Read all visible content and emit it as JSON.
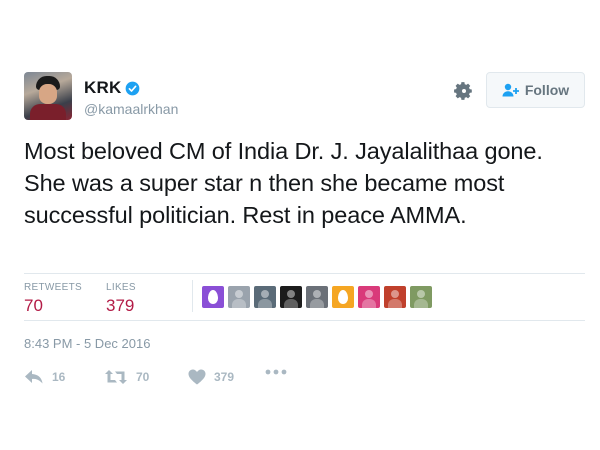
{
  "user": {
    "name": "KRK",
    "handle": "@kamaalrkhan",
    "verified": true
  },
  "follow_button": {
    "label": "Follow"
  },
  "tweet": {
    "text": "Most beloved CM of India Dr. J. Jayalalithaa gone. She was a super star n then she became most successful politician. Rest in peace AMMA.",
    "timestamp": "8:43 PM - 5 Dec 2016"
  },
  "stats": {
    "retweets_label": "RETWEETS",
    "retweets_value": "70",
    "likes_label": "LIKES",
    "likes_value": "379"
  },
  "actions": {
    "reply_count": "16",
    "retweet_count": "70",
    "like_count": "379"
  },
  "likers": [
    {
      "kind": "egg",
      "color": "#8a4fd6"
    },
    {
      "kind": "photo",
      "color": "#9aa3ad"
    },
    {
      "kind": "photo",
      "color": "#5a6b78"
    },
    {
      "kind": "photo",
      "color": "#1c1c1c"
    },
    {
      "kind": "photo",
      "color": "#6b7078"
    },
    {
      "kind": "egg",
      "color": "#f5a623"
    },
    {
      "kind": "photo",
      "color": "#d93a7a"
    },
    {
      "kind": "photo",
      "color": "#c0402c"
    },
    {
      "kind": "photo",
      "color": "#7f9a62"
    }
  ],
  "colors": {
    "stat_value": "#b31b46",
    "muted": "#8899a6",
    "verified": "#1da1f2"
  }
}
